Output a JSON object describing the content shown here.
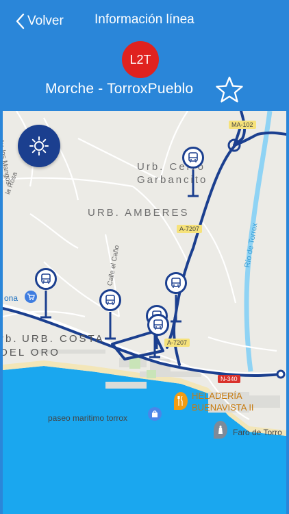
{
  "header": {
    "back_label": "Volver",
    "title": "Información línea",
    "line_code": "L2T",
    "route_name": "Morche - TorroxPueblo"
  },
  "map": {
    "labels": {
      "urb_cerro": "Urb. Cerro",
      "garbancito": "Garbancito",
      "urb_amberes": "URB. AMBERES",
      "urb_costa": "URB. COSTA",
      "del_oro": "DEL ORO",
      "calle_cano": "Calle el Caño",
      "av_mangos": "Av. los Mangos",
      "la_rosa": "la Rosa",
      "rio_torrox": "Río de Torrox",
      "heladeria_1": "HELADERÍA",
      "heladeria_2": "BUENAVISTA II",
      "paseo": "paseo maritimo torrox",
      "faro": "Faro de Torro",
      "ona": "ona",
      "rb": "rb."
    },
    "roads": {
      "ma": "MA-102",
      "a7207_1": "A-7207",
      "a7207_2": "A-7207",
      "n340": "N-340"
    }
  },
  "colors": {
    "header": "#2a86d9",
    "badge": "#e0221f",
    "route": "#1b3f8f",
    "sea": "#1aa7ef"
  },
  "icons": [
    "chevron-left-icon",
    "star-outline-icon",
    "sun-icon",
    "bus-stop-icon",
    "shopping-cart-icon",
    "restaurant-icon",
    "shopping-bag-icon",
    "lighthouse-icon"
  ]
}
